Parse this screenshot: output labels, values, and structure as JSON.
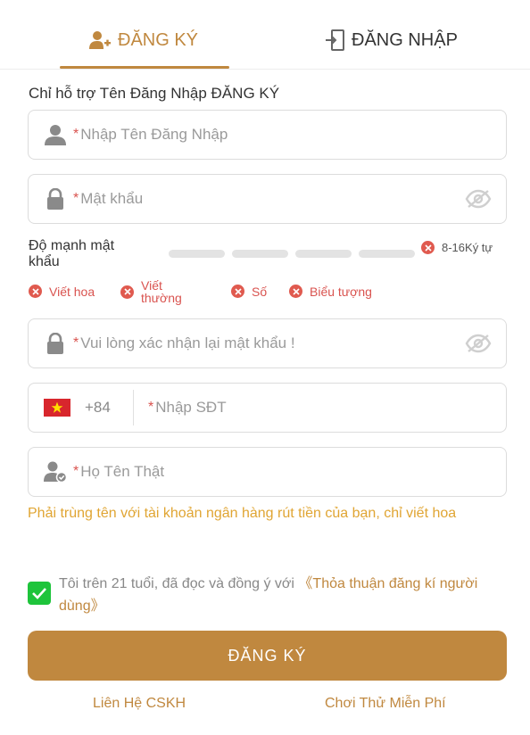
{
  "tabs": {
    "register_label": "ĐĂNG KÝ",
    "login_label": "ĐĂNG NHẬP"
  },
  "hint_top": "Chỉ hỗ trợ Tên Đăng Nhập ĐĂNG KÝ",
  "username": {
    "required_mark": "*",
    "placeholder": "Nhập Tên Đăng Nhập",
    "value": ""
  },
  "password": {
    "required_mark": "*",
    "placeholder": "Mật khẩu",
    "value": ""
  },
  "strength": {
    "label": "Độ mạnh mật khẩu",
    "length_rule": "8-16Ký tự",
    "rules": [
      "Viết hoa",
      "Viết thường",
      "Số",
      "Biểu tượng"
    ]
  },
  "confirm_password": {
    "required_mark": "*",
    "placeholder": "Vui lòng xác nhận lại mật khẩu !",
    "value": ""
  },
  "phone": {
    "dial_code": "+84",
    "required_mark": "*",
    "placeholder": "Nhập SĐT",
    "value": ""
  },
  "real_name": {
    "required_mark": "*",
    "placeholder": "Họ Tên Thật",
    "value": ""
  },
  "name_hint": "Phải trùng tên với tài khoản ngân hàng rút tiền của bạn, chỉ viết hoa",
  "agreement": {
    "checked": true,
    "text": "Tôi trên 21 tuổi, đã đọc và đồng ý với ",
    "link": "《Thỏa thuận đăng kí người dùng》"
  },
  "submit_label": "ĐĂNG KÝ",
  "footer": {
    "contact_label": "Liên Hệ CSKH",
    "trial_label": "Chơi Thử Miễn Phí"
  },
  "colors": {
    "accent": "#c0883f",
    "error": "#d9534f",
    "hint": "#e0a533",
    "check": "#1ec43b"
  }
}
